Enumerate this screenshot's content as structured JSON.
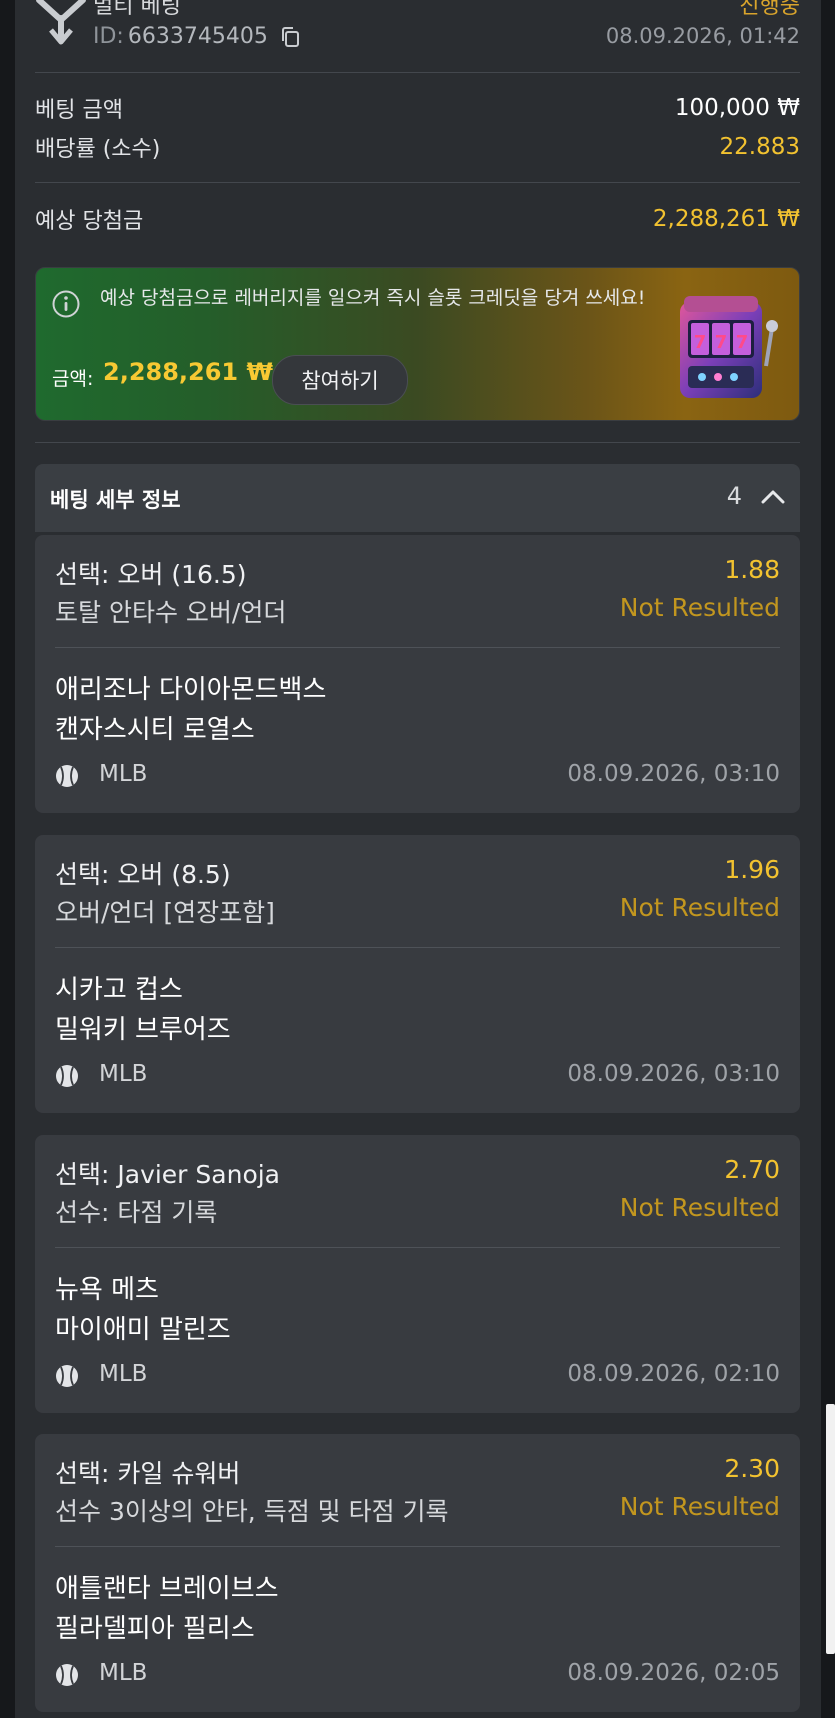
{
  "bet": {
    "type_label": "멀티 베팅",
    "id_label": "ID:",
    "id_value": "6633745405",
    "status": "진행중",
    "placed_at": "08.09.2026, 01:42"
  },
  "summary": {
    "stake_label": "베팅 금액",
    "stake_value": "100,000 ₩",
    "odds_label": "배당률 (소수)",
    "odds_value": "22.883",
    "payout_label": "예상 당첨금",
    "payout_value": "2,288,261 ₩"
  },
  "promo": {
    "text": "예상 당첨금으로 레버리지를 일으켜 즉시 슬롯 크레딧을 당겨 쓰세요!",
    "amount_label": "금액:",
    "amount_value": "2,288,261 ₩",
    "button_label": "참여하기",
    "slot_digits": "777"
  },
  "details": {
    "title": "베팅 세부 정보",
    "count": "4"
  },
  "selections": [
    {
      "selection": "선택: 오버 (16.5)",
      "odds": "1.88",
      "market": "토탈 안타수 오버/언더",
      "result": "Not Resulted",
      "team1": "애리조나 다이아몬드백스",
      "team2": "캔자스시티 로열스",
      "league": "MLB",
      "time": "08.09.2026, 03:10"
    },
    {
      "selection": "선택: 오버 (8.5)",
      "odds": "1.96",
      "market": "오버/언더 [연장포함]",
      "result": "Not Resulted",
      "team1": "시카고 컵스",
      "team2": "밀워키 브루어즈",
      "league": "MLB",
      "time": "08.09.2026, 03:10"
    },
    {
      "selection": "선택: Javier Sanoja",
      "odds": "2.70",
      "market": "선수: 타점 기록",
      "result": "Not Resulted",
      "team1": "뉴욕 메츠",
      "team2": "마이애미 말린즈",
      "league": "MLB",
      "time": "08.09.2026, 02:10"
    },
    {
      "selection": "선택: 카일 슈워버",
      "odds": "2.30",
      "market": "선수 3이상의 안타, 득점 및 타점 기록",
      "result": "Not Resulted",
      "team1": "애틀랜타 브레이브스",
      "team2": "필라델피아 필리스",
      "league": "MLB",
      "time": "08.09.2026, 02:05"
    }
  ],
  "icons": {
    "multi": "multi-bet-icon",
    "copy": "copy-icon",
    "info": "info-icon",
    "chevron": "chevron-up-icon",
    "ball": "baseball-icon",
    "slot": "slot-machine-icon"
  },
  "colors": {
    "accent_yellow": "#f2c230",
    "status_orange": "#d9a42c",
    "result_gold": "#c2961f",
    "panel": "#2a2d31",
    "card": "#383b40"
  }
}
